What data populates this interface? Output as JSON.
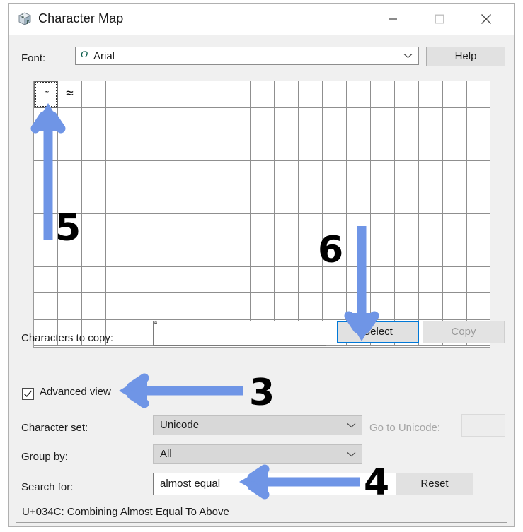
{
  "window": {
    "title": "Character Map",
    "icon": "character-map-icon",
    "controls": {
      "minimize": "minimize-icon",
      "maximize": "maximize-icon",
      "close": "close-icon"
    }
  },
  "font_row": {
    "label": "Font:",
    "value": "Arial",
    "value_icon": "O",
    "caret_icon": "chevron-down-icon",
    "help_label": "Help"
  },
  "grid": {
    "columns": 19,
    "rows": 10,
    "selected_index": 0,
    "cells": [
      {
        "glyph": "̄̃",
        "small": true,
        "selected": true
      },
      {
        "glyph": "≈",
        "small": false,
        "selected": false
      }
    ]
  },
  "characters_to_copy": {
    "label": "Characters to copy:",
    "value": "͌",
    "select_label": "Select",
    "copy_label": "Copy"
  },
  "advanced_view": {
    "label": "Advanced view",
    "checked": true,
    "check_icon": "checkmark-icon"
  },
  "character_set": {
    "label": "Character set:",
    "value": "Unicode",
    "caret_icon": "chevron-down-icon"
  },
  "go_to_unicode": {
    "label": "Go to Unicode:",
    "value": "",
    "disabled": true
  },
  "group_by": {
    "label": "Group by:",
    "value": "All",
    "caret_icon": "chevron-down-icon"
  },
  "search": {
    "label": "Search for:",
    "value": "almost equal",
    "placeholder": "",
    "reset_label": "Reset"
  },
  "statusbar": {
    "text": "U+034C: Combining Almost Equal To Above"
  },
  "annotations": {
    "arrow_color": "#6f95e6",
    "number_color": "#000000",
    "items": [
      {
        "number": "3",
        "direction": "left",
        "target": "advanced-view-checkbox"
      },
      {
        "number": "4",
        "direction": "left",
        "target": "search-input"
      },
      {
        "number": "5",
        "direction": "up",
        "target": "character-grid-cell-selected"
      },
      {
        "number": "6",
        "direction": "down",
        "target": "select-button"
      }
    ]
  }
}
